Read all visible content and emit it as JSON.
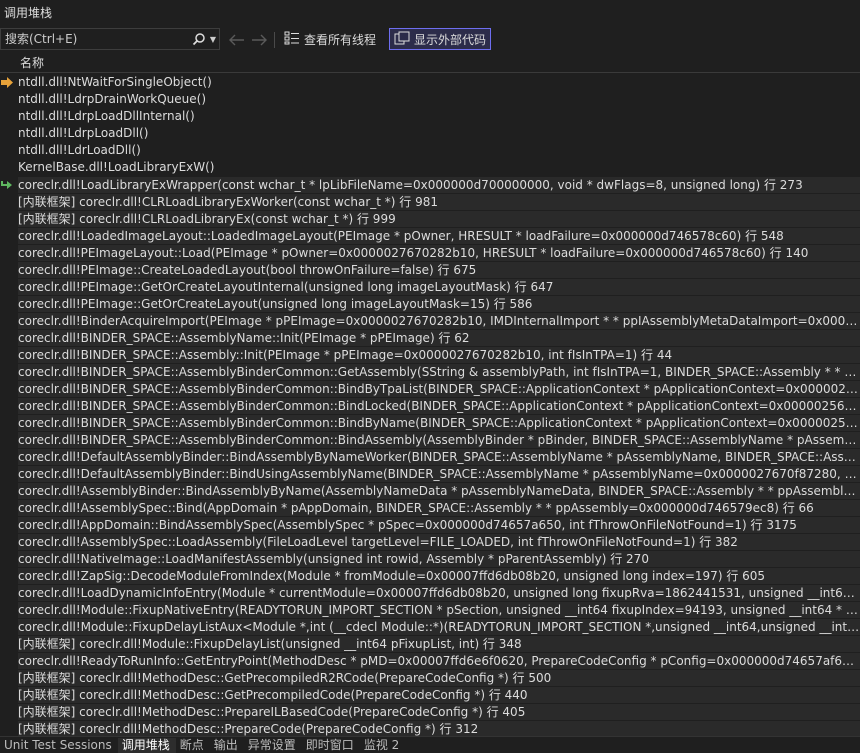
{
  "panel": {
    "title": "调用堆栈"
  },
  "toolbar": {
    "search_placeholder": "搜索(Ctrl+E)",
    "view_all_threads": "查看所有线程",
    "show_external_code": "显示外部代码"
  },
  "table": {
    "column_name": "名称"
  },
  "rows": [
    {
      "text": "ntdll.dll!NtWaitForSingleObject()",
      "marker": "current"
    },
    {
      "text": "ntdll.dll!LdrpDrainWorkQueue()"
    },
    {
      "text": "ntdll.dll!LdrpLoadDllInternal()"
    },
    {
      "text": "ntdll.dll!LdrpLoadDll()"
    },
    {
      "text": "ntdll.dll!LdrLoadDll()"
    },
    {
      "text": "KernelBase.dll!LoadLibraryExW()"
    },
    {
      "text": "coreclr.dll!LoadLibraryExWrapper(const wchar_t * lpLibFileName=0x000000d700000000, void * dwFlags=8, unsigned long) 行 273",
      "marker": "return"
    },
    {
      "text": "[内联框架] coreclr.dll!CLRLoadLibraryExWorker(const wchar_t *) 行 981"
    },
    {
      "text": "[内联框架] coreclr.dll!CLRLoadLibraryEx(const wchar_t *) 行 999"
    },
    {
      "text": "coreclr.dll!LoadedImageLayout::LoadedImageLayout(PEImage * pOwner, HRESULT * loadFailure=0x000000d746578c60) 行 548"
    },
    {
      "text": "coreclr.dll!PEImageLayout::Load(PEImage * pOwner=0x0000027670282b10, HRESULT * loadFailure=0x000000d746578c60) 行 140"
    },
    {
      "text": "coreclr.dll!PEImage::CreateLoadedLayout(bool throwOnFailure=false) 行 675"
    },
    {
      "text": "coreclr.dll!PEImage::GetOrCreateLayoutInternal(unsigned long imageLayoutMask) 行 647"
    },
    {
      "text": "coreclr.dll!PEImage::GetOrCreateLayout(unsigned long imageLayoutMask=15) 行 586"
    },
    {
      "text": "coreclr.dll!BinderAcquireImport(PEImage * pPEImage=0x0000027670282b10, IMDInternalImport * * ppIAssemblyMetaDataImport=0x000000d746578e10, unsig..."
    },
    {
      "text": "coreclr.dll!BINDER_SPACE::AssemblyName::Init(PEImage * pPEImage) 行 62"
    },
    {
      "text": "coreclr.dll!BINDER_SPACE::Assembly::Init(PEImage * pPEImage=0x0000027670282b10, int fIsInTPA=1) 行 44"
    },
    {
      "text": "coreclr.dll!BINDER_SPACE::AssemblyBinderCommon::GetAssembly(SString & assemblyPath, int fIsInTPA=1, BINDER_SPACE::Assembly * * ppAssembly=0x000..."
    },
    {
      "text": "coreclr.dll!BINDER_SPACE::AssemblyBinderCommon::BindByTpaList(BINDER_SPACE::ApplicationContext * pApplicationContext=0x0000025669b2a920, BINDE..."
    },
    {
      "text": "coreclr.dll!BINDER_SPACE::AssemblyBinderCommon::BindLocked(BINDER_SPACE::ApplicationContext * pApplicationContext=0x0000025669b2a920, BINDER_S..."
    },
    {
      "text": "coreclr.dll!BINDER_SPACE::AssemblyBinderCommon::BindByName(BINDER_SPACE::ApplicationContext * pApplicationContext=0x0000025669b2a920, BINDER..."
    },
    {
      "text": "coreclr.dll!BINDER_SPACE::AssemblyBinderCommon::BindAssembly(AssemblyBinder * pBinder, BINDER_SPACE::AssemblyName * pAssemblyName=0x000002..."
    },
    {
      "text": "coreclr.dll!DefaultAssemblyBinder::BindAssemblyByNameWorker(BINDER_SPACE::AssemblyName * pAssemblyName, BINDER_SPACE::Assembly * * ppCoreC..."
    },
    {
      "text": "coreclr.dll!DefaultAssemblyBinder::BindUsingAssemblyName(BINDER_SPACE::AssemblyName * pAssemblyName=0x0000027670f87280, BINDER_SPACE::Asse..."
    },
    {
      "text": "coreclr.dll!AssemblyBinder::BindAssemblyByName(AssemblyNameData * pAssemblyNameData, BINDER_SPACE::Assembly * * ppAssembly=0x000000d746579..."
    },
    {
      "text": "coreclr.dll!AssemblySpec::Bind(AppDomain * pAppDomain, BINDER_SPACE::Assembly * * ppAssembly=0x000000d746579ec8) 行 66"
    },
    {
      "text": "coreclr.dll!AppDomain::BindAssemblySpec(AssemblySpec * pSpec=0x000000d74657a650, int fThrowOnFileNotFound=1) 行 3175"
    },
    {
      "text": "coreclr.dll!AssemblySpec::LoadAssembly(FileLoadLevel targetLevel=FILE_LOADED, int fThrowOnFileNotFound=1) 行 382"
    },
    {
      "text": "coreclr.dll!NativeImage::LoadManifestAssembly(unsigned int rowid, Assembly * pParentAssembly) 行 270"
    },
    {
      "text": "coreclr.dll!ZapSig::DecodeModuleFromIndex(Module * fromModule=0x00007ffd6db08b20, unsigned long index=197) 行 605"
    },
    {
      "text": "coreclr.dll!LoadDynamicInfoEntry(Module * currentModule=0x00007ffd6db08b20, unsigned long fixupRva=1862441531, unsigned __int64 * entry=0x00007ffd4..."
    },
    {
      "text": "coreclr.dll!Module::FixupNativeEntry(READYTORUN_IMPORT_SECTION * pSection, unsigned __int64 fixupIndex=94193, unsigned __int64 * fixupCell=0x00007ff..."
    },
    {
      "text": "coreclr.dll!Module::FixupDelayListAux<Module *,int (__cdecl Module::*)(READYTORUN_IMPORT_SECTION *,unsigned __int64,unsigned __int64 *,int)>(unsigne..."
    },
    {
      "text": "[内联框架] coreclr.dll!Module::FixupDelayList(unsigned __int64 pFixupList, int) 行 348"
    },
    {
      "text": "coreclr.dll!ReadyToRunInfo::GetEntryPoint(MethodDesc * pMD=0x00007ffd6e6f0620, PrepareCodeConfig * pConfig=0x000000d74657af60, int) 行 1257"
    },
    {
      "text": "[内联框架] coreclr.dll!MethodDesc::GetPrecompiledR2RCode(PrepareCodeConfig *) 行 500"
    },
    {
      "text": "[内联框架] coreclr.dll!MethodDesc::GetPrecompiledCode(PrepareCodeConfig *) 行 440"
    },
    {
      "text": "[内联框架] coreclr.dll!MethodDesc::PrepareILBasedCode(PrepareCodeConfig *) 行 405"
    },
    {
      "text": "[内联框架] coreclr.dll!MethodDesc::PrepareCode(PrepareCodeConfig *) 行 312"
    }
  ],
  "bottom_tabs": [
    {
      "label": "Unit Test Sessions"
    },
    {
      "label": "调用堆栈",
      "active": true
    },
    {
      "label": "断点"
    },
    {
      "label": "输出"
    },
    {
      "label": "异常设置"
    },
    {
      "label": "即时窗口"
    },
    {
      "label": "监视 2"
    }
  ],
  "colors": {
    "accent": "#6e6ef0",
    "current_marker": "#e8a33a",
    "return_marker": "#5fb760"
  }
}
